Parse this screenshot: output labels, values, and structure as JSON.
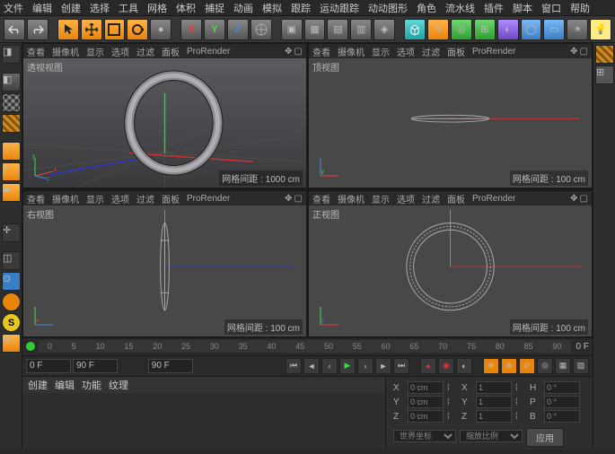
{
  "menu": [
    "文件",
    "编辑",
    "创建",
    "选择",
    "工具",
    "网格",
    "体积",
    "捕捉",
    "动画",
    "模拟",
    "跟踪",
    "运动跟踪",
    "动动图形",
    "角色",
    "流水线",
    "插件",
    "脚本",
    "窗口",
    "帮助"
  ],
  "viewport_menu": [
    "查看",
    "摄像机",
    "显示",
    "选项",
    "过滤",
    "面板",
    "ProRender"
  ],
  "vp1": {
    "title": "透视视图",
    "info": "网格间距 : 1000 cm"
  },
  "vp2": {
    "title": "顶视图",
    "info": "网格间距 : 100 cm"
  },
  "vp3": {
    "title": "右视图",
    "info": "网格间距 : 100 cm"
  },
  "vp4": {
    "title": "正视图",
    "info": "网格间距 : 100 cm"
  },
  "timeline": {
    "start": "0 F",
    "end": "90 F",
    "current": "90 F",
    "marks": [
      "0",
      "5",
      "10",
      "15",
      "20",
      "25",
      "30",
      "35",
      "40",
      "45",
      "50",
      "55",
      "60",
      "65",
      "70",
      "75",
      "80",
      "85",
      "90"
    ],
    "rightlabel": "0 F"
  },
  "tabs": [
    "创建",
    "编辑",
    "功能",
    "纹理"
  ],
  "attrs": {
    "X": {
      "pos": "0 cm",
      "rot": "0 °",
      "scale": "1",
      "h": "H",
      "hval": "0 °"
    },
    "Y": {
      "pos": "0 cm",
      "rot": "0 °",
      "scale": "1",
      "p": "P",
      "pval": "0 °"
    },
    "Z": {
      "pos": "0 cm",
      "rot": "0 °",
      "scale": "1",
      "b": "B",
      "bval": "0 °"
    },
    "dropdown1": "世界坐标",
    "dropdown2": "缩放比例",
    "apply": "应用"
  }
}
